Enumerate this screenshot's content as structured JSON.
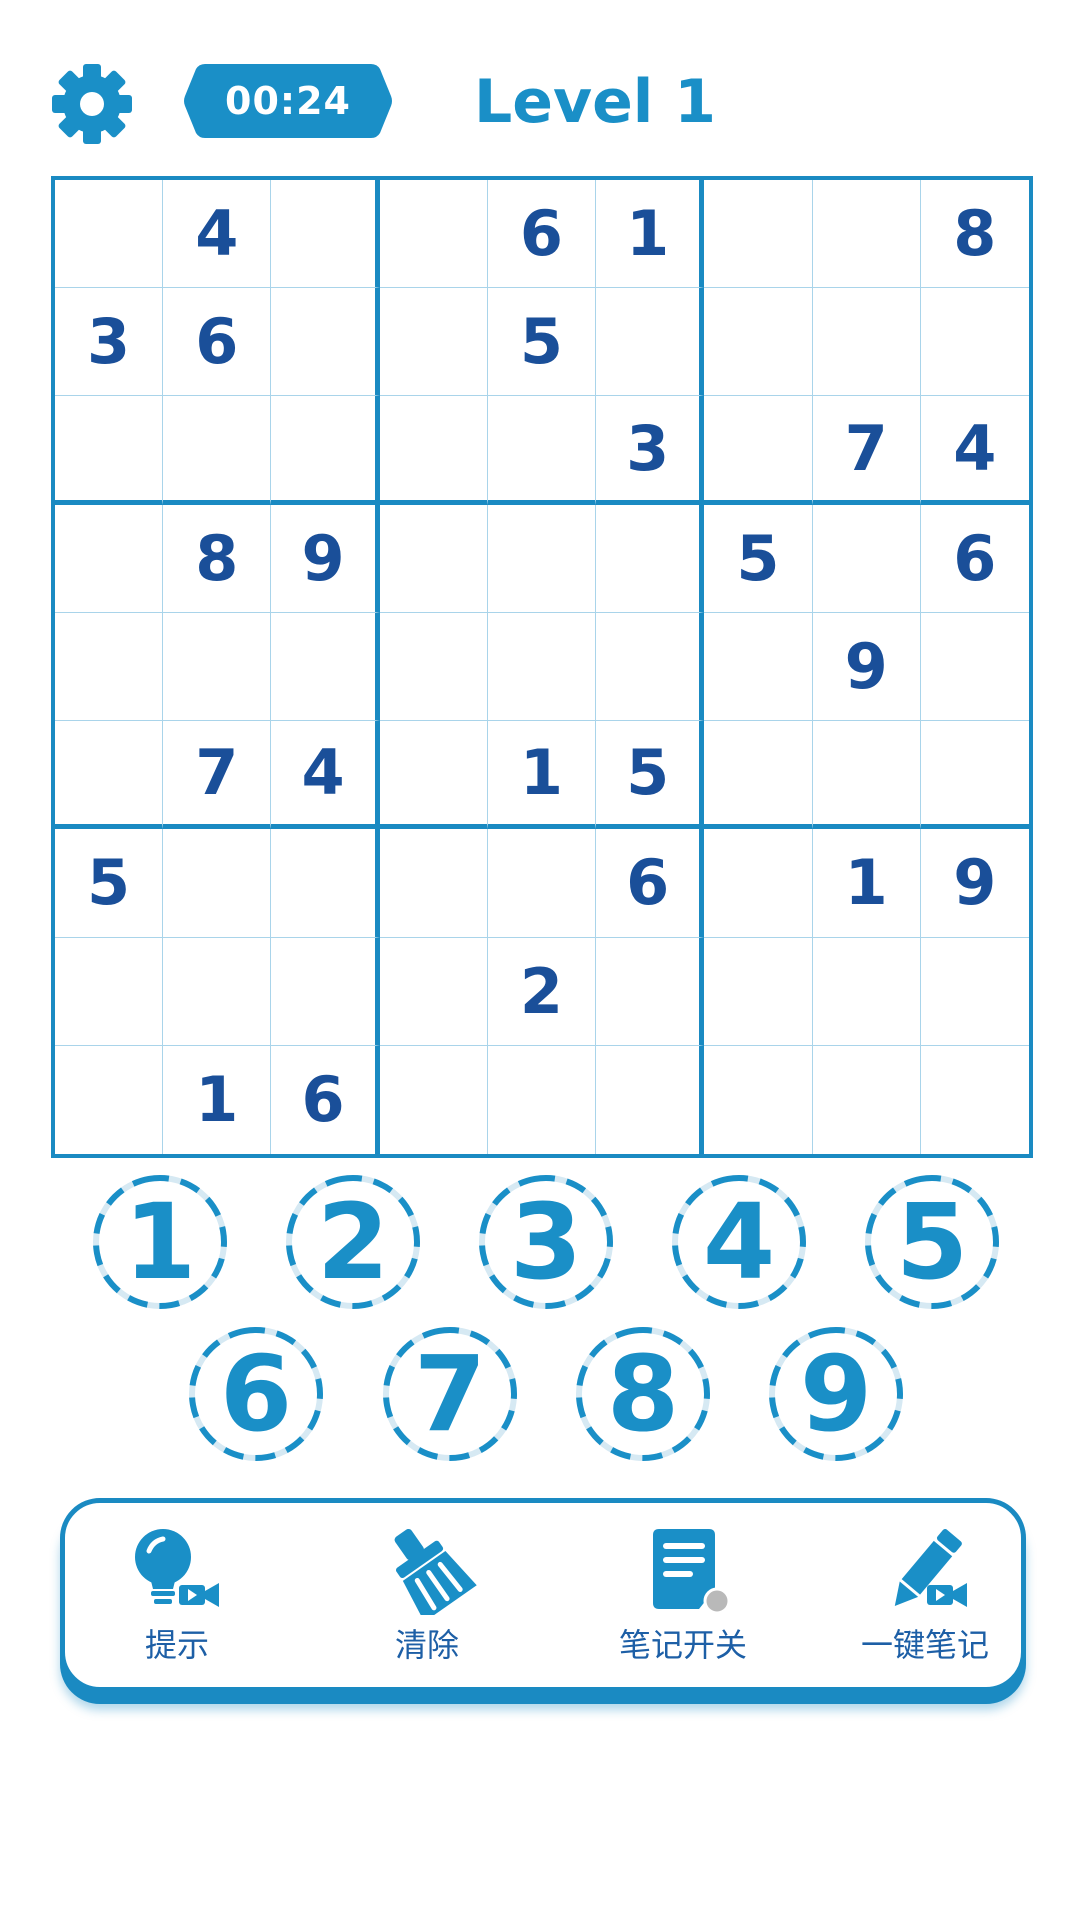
{
  "header": {
    "timer": "00:24",
    "level_title": "Level 1"
  },
  "board": {
    "rows": [
      [
        "",
        "4",
        "",
        "",
        "6",
        "1",
        "",
        "",
        "8"
      ],
      [
        "3",
        "6",
        "",
        "",
        "5",
        "",
        "",
        "",
        ""
      ],
      [
        "",
        "",
        "",
        "",
        "",
        "3",
        "",
        "7",
        "4"
      ],
      [
        "",
        "8",
        "9",
        "",
        "",
        "",
        "5",
        "",
        "6"
      ],
      [
        "",
        "",
        "",
        "",
        "",
        "",
        "",
        "9",
        ""
      ],
      [
        "",
        "7",
        "4",
        "",
        "1",
        "5",
        "",
        "",
        ""
      ],
      [
        "5",
        "",
        "",
        "",
        "",
        "6",
        "",
        "1",
        "9"
      ],
      [
        "",
        "",
        "",
        "",
        "2",
        "",
        "",
        "",
        ""
      ],
      [
        "",
        "1",
        "6",
        "",
        "",
        "",
        "",
        "",
        ""
      ]
    ]
  },
  "numpad": {
    "numbers": [
      "1",
      "2",
      "3",
      "4",
      "5",
      "6",
      "7",
      "8",
      "9"
    ]
  },
  "toolbar": {
    "hint_label": "提示",
    "clear_label": "清除",
    "notes_toggle_label": "笔记开关",
    "auto_notes_label": "一键笔记",
    "notes_toggle_state": "off"
  },
  "colors": {
    "accent": "#1a8fc7",
    "digit": "#1a4f99",
    "grid_thin": "#a9d4ea",
    "grid_thick": "#1a8ac2"
  }
}
